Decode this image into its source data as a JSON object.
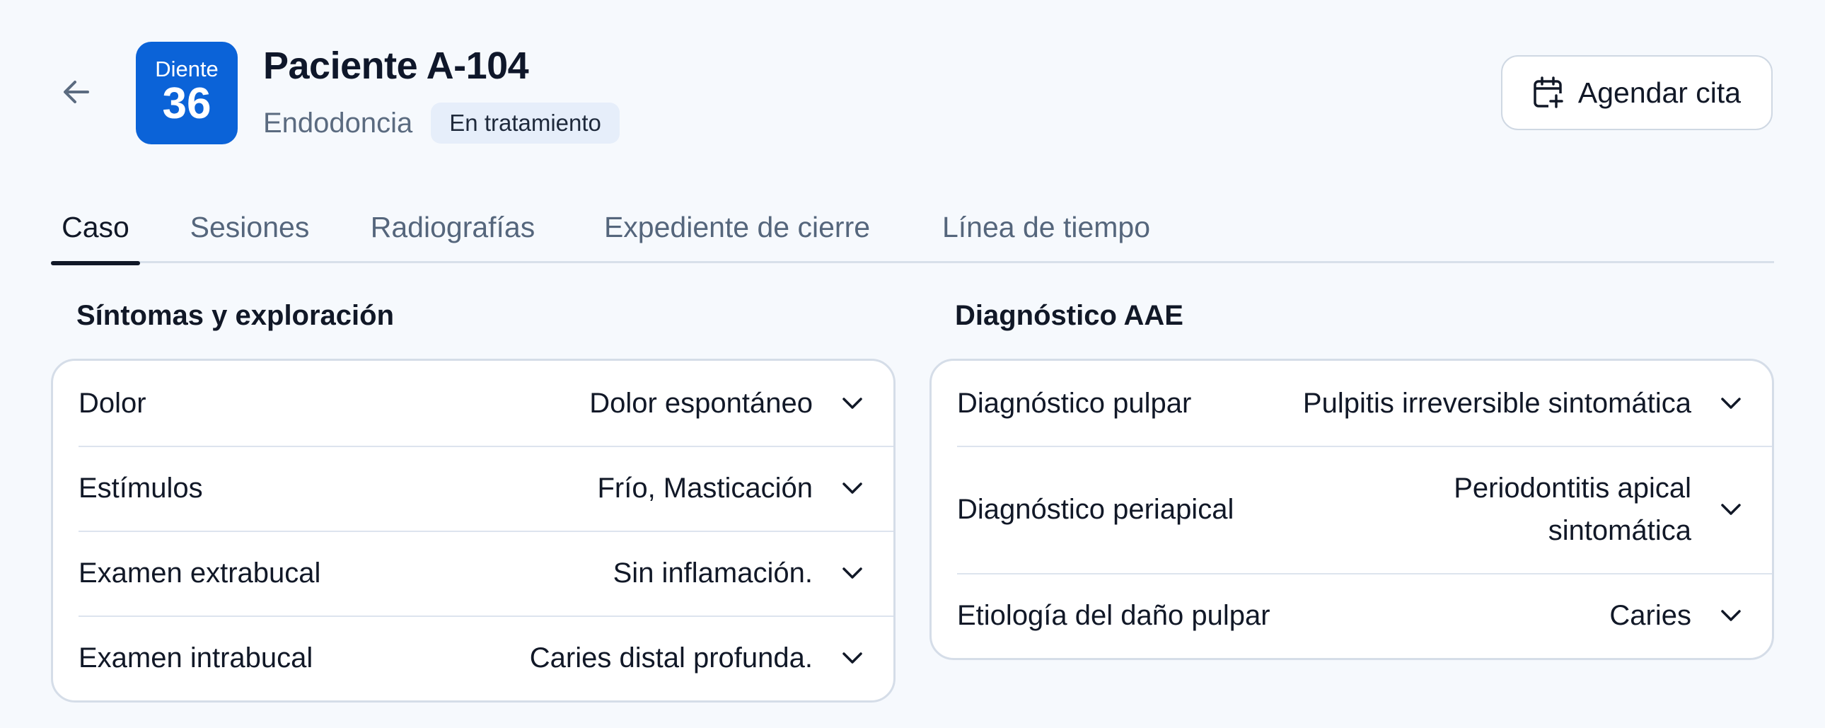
{
  "header": {
    "tooth_label": "Diente",
    "tooth_number": "36",
    "patient_title": "Paciente A-104",
    "specialty": "Endodoncia",
    "status": "En tratamiento",
    "schedule_button": "Agendar cita"
  },
  "tabs": [
    {
      "label": "Caso",
      "active": true
    },
    {
      "label": "Sesiones",
      "active": false
    },
    {
      "label": "Radiografías",
      "active": false
    },
    {
      "label": "Expediente de cierre",
      "active": false
    },
    {
      "label": "Línea de tiempo",
      "active": false
    }
  ],
  "symptoms": {
    "title": "Síntomas y exploración",
    "rows": [
      {
        "label": "Dolor",
        "value": "Dolor espontáneo"
      },
      {
        "label": "Estímulos",
        "value": "Frío, Masticación"
      },
      {
        "label": "Examen extrabucal",
        "value": "Sin inflamación."
      },
      {
        "label": "Examen intrabucal",
        "value": "Caries distal profunda."
      }
    ]
  },
  "diagnosis": {
    "title": "Diagnóstico AAE",
    "rows": [
      {
        "label": "Diagnóstico pulpar",
        "value": "Pulpitis irreversible sintomática"
      },
      {
        "label": "Diagnóstico periapical",
        "value_line1": "Periodontitis apical",
        "value_line2": "sintomática"
      },
      {
        "label": "Etiología del daño pulpar",
        "value": "Caries"
      }
    ]
  },
  "icons": {
    "back": "arrow-left-icon",
    "calendar": "calendar-plus-icon",
    "chevron": "chevron-down-icon"
  },
  "colors": {
    "accent": "#0b63d8",
    "background": "#f6f9fd",
    "badge_bg": "#e6eefa"
  }
}
